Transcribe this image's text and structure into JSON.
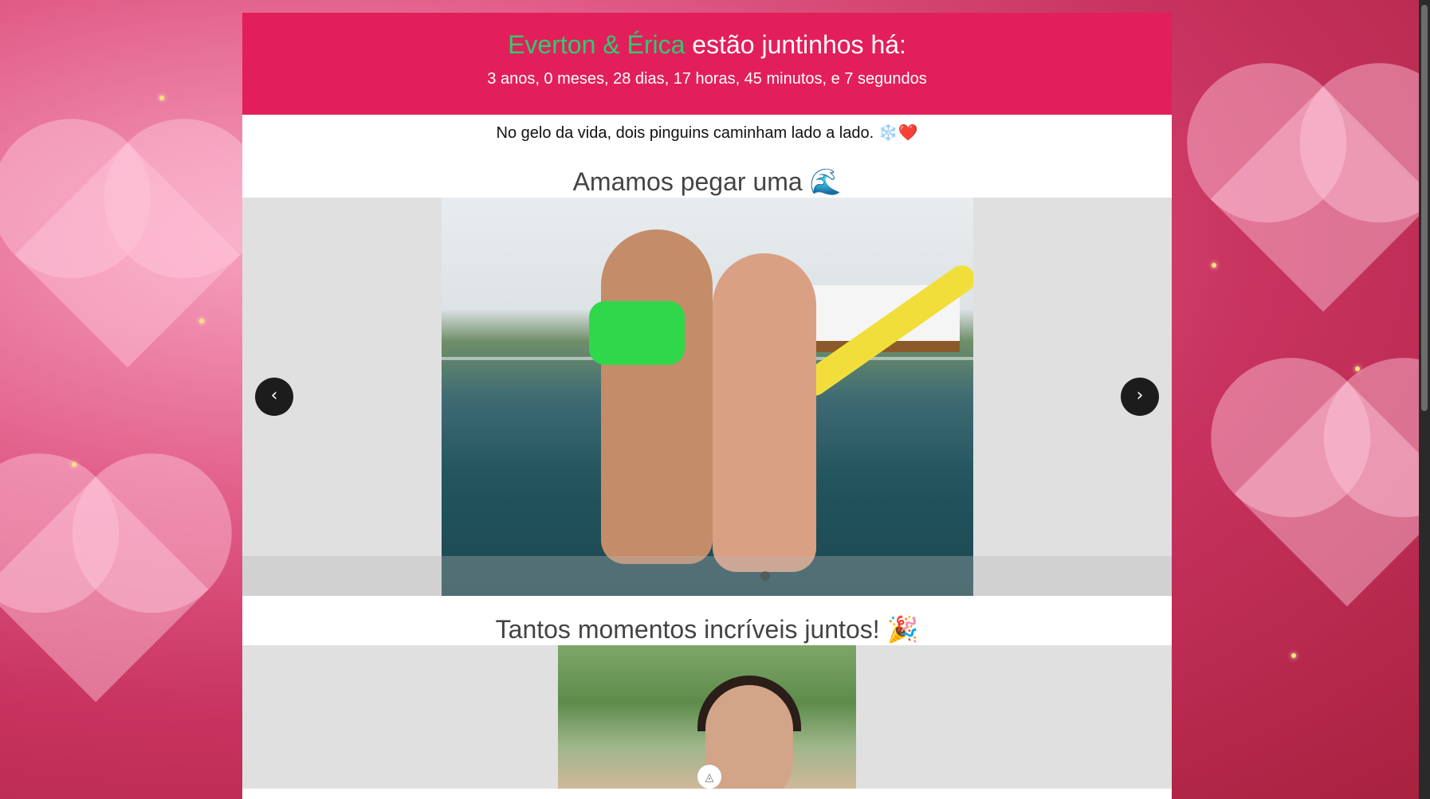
{
  "header": {
    "names": "Everton & Érica",
    "title_suffix": " estão juntinhos há:",
    "counter": "3 anos, 0 meses, 28 dias, 17 horas, 45 minutos, e 7 segundos"
  },
  "tagline": "No gelo da vida, dois pinguins caminham lado a lado. ❄️❤️",
  "section1": {
    "title": "Amamos pegar uma 🌊"
  },
  "carousel": {
    "prev_icon": "‹",
    "next_icon": "›"
  },
  "section2": {
    "title": "Tantos momentos incríveis juntos! 🎉"
  },
  "colors": {
    "header_bg": "#e21f5b",
    "names": "#2ecc71",
    "nav_button": "#1c1c1c"
  }
}
